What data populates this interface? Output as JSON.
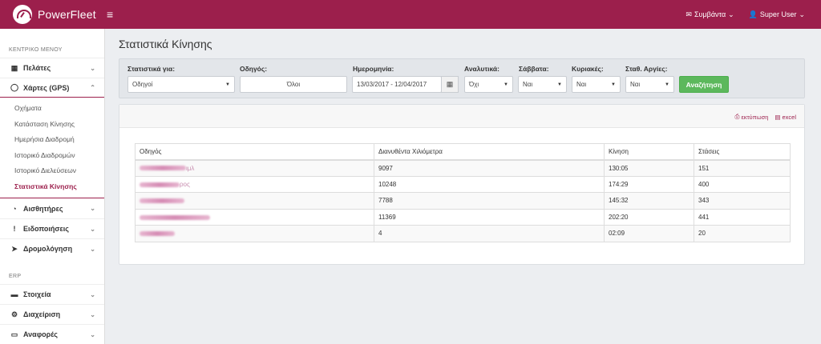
{
  "app": {
    "title": "PowerFleet",
    "menu_icon": "hamburger-icon"
  },
  "topbar": {
    "alerts_label": "Συμβάντα",
    "user_label": "Super User"
  },
  "sidebar": {
    "section_main": "ΚΕΝΤΡΙΚΟ ΜΕΝΟΥ",
    "customers": "Πελάτες",
    "maps": "Χάρτες (GPS)",
    "maps_sub": [
      "Οχήματα",
      "Κατάσταση Κίνησης",
      "Ημερήσια Διαδρομή",
      "Ιστορικό Διαδρομών",
      "Ιστορικό Διελεύσεων",
      "Στατιστικά Κίνησης"
    ],
    "sensors": "Αισθητήρες",
    "notifications": "Ειδοποιήσεις",
    "routing": "Δρομολόγηση",
    "section_erp": "ERP",
    "data": "Στοιχεία",
    "management": "Διαχείριση",
    "reports": "Αναφορές"
  },
  "page": {
    "title": "Στατιστικά Κίνησης"
  },
  "filters": {
    "stats_for_label": "Στατιστικά για:",
    "stats_for_value": "Οδηγοί",
    "driver_label": "Οδηγός:",
    "driver_value": "Όλοι",
    "date_label": "Ημερομηνία:",
    "date_value": "13/03/2017 - 12/04/2017",
    "detailed_label": "Αναλυτικά:",
    "detailed_value": "Όχι",
    "saturdays_label": "Σάββατα:",
    "saturdays_value": "Ναι",
    "sundays_label": "Κυριακές:",
    "sundays_value": "Ναι",
    "holidays_label": "Σταθ. Αργίες:",
    "holidays_value": "Ναι",
    "search_button": "Αναζήτηση"
  },
  "actions": {
    "print": "εκτύπωση",
    "excel": "excel"
  },
  "table": {
    "headers": [
      "Οδηγός",
      "Διανυθέντα Χιλιόμετρα",
      "Κίνηση",
      "Στάσεις"
    ],
    "rows": [
      {
        "name_suffix": "ιμλ",
        "km": "9097",
        "motion": "130:05",
        "stops": "151"
      },
      {
        "name_suffix": "ρος",
        "km": "10248",
        "motion": "174:29",
        "stops": "400"
      },
      {
        "name_suffix": "",
        "km": "7788",
        "motion": "145:32",
        "stops": "343"
      },
      {
        "name_suffix": "",
        "km": "11369",
        "motion": "202:20",
        "stops": "441"
      },
      {
        "name_suffix": "",
        "km": "4",
        "motion": "02:09",
        "stops": "20"
      }
    ]
  }
}
